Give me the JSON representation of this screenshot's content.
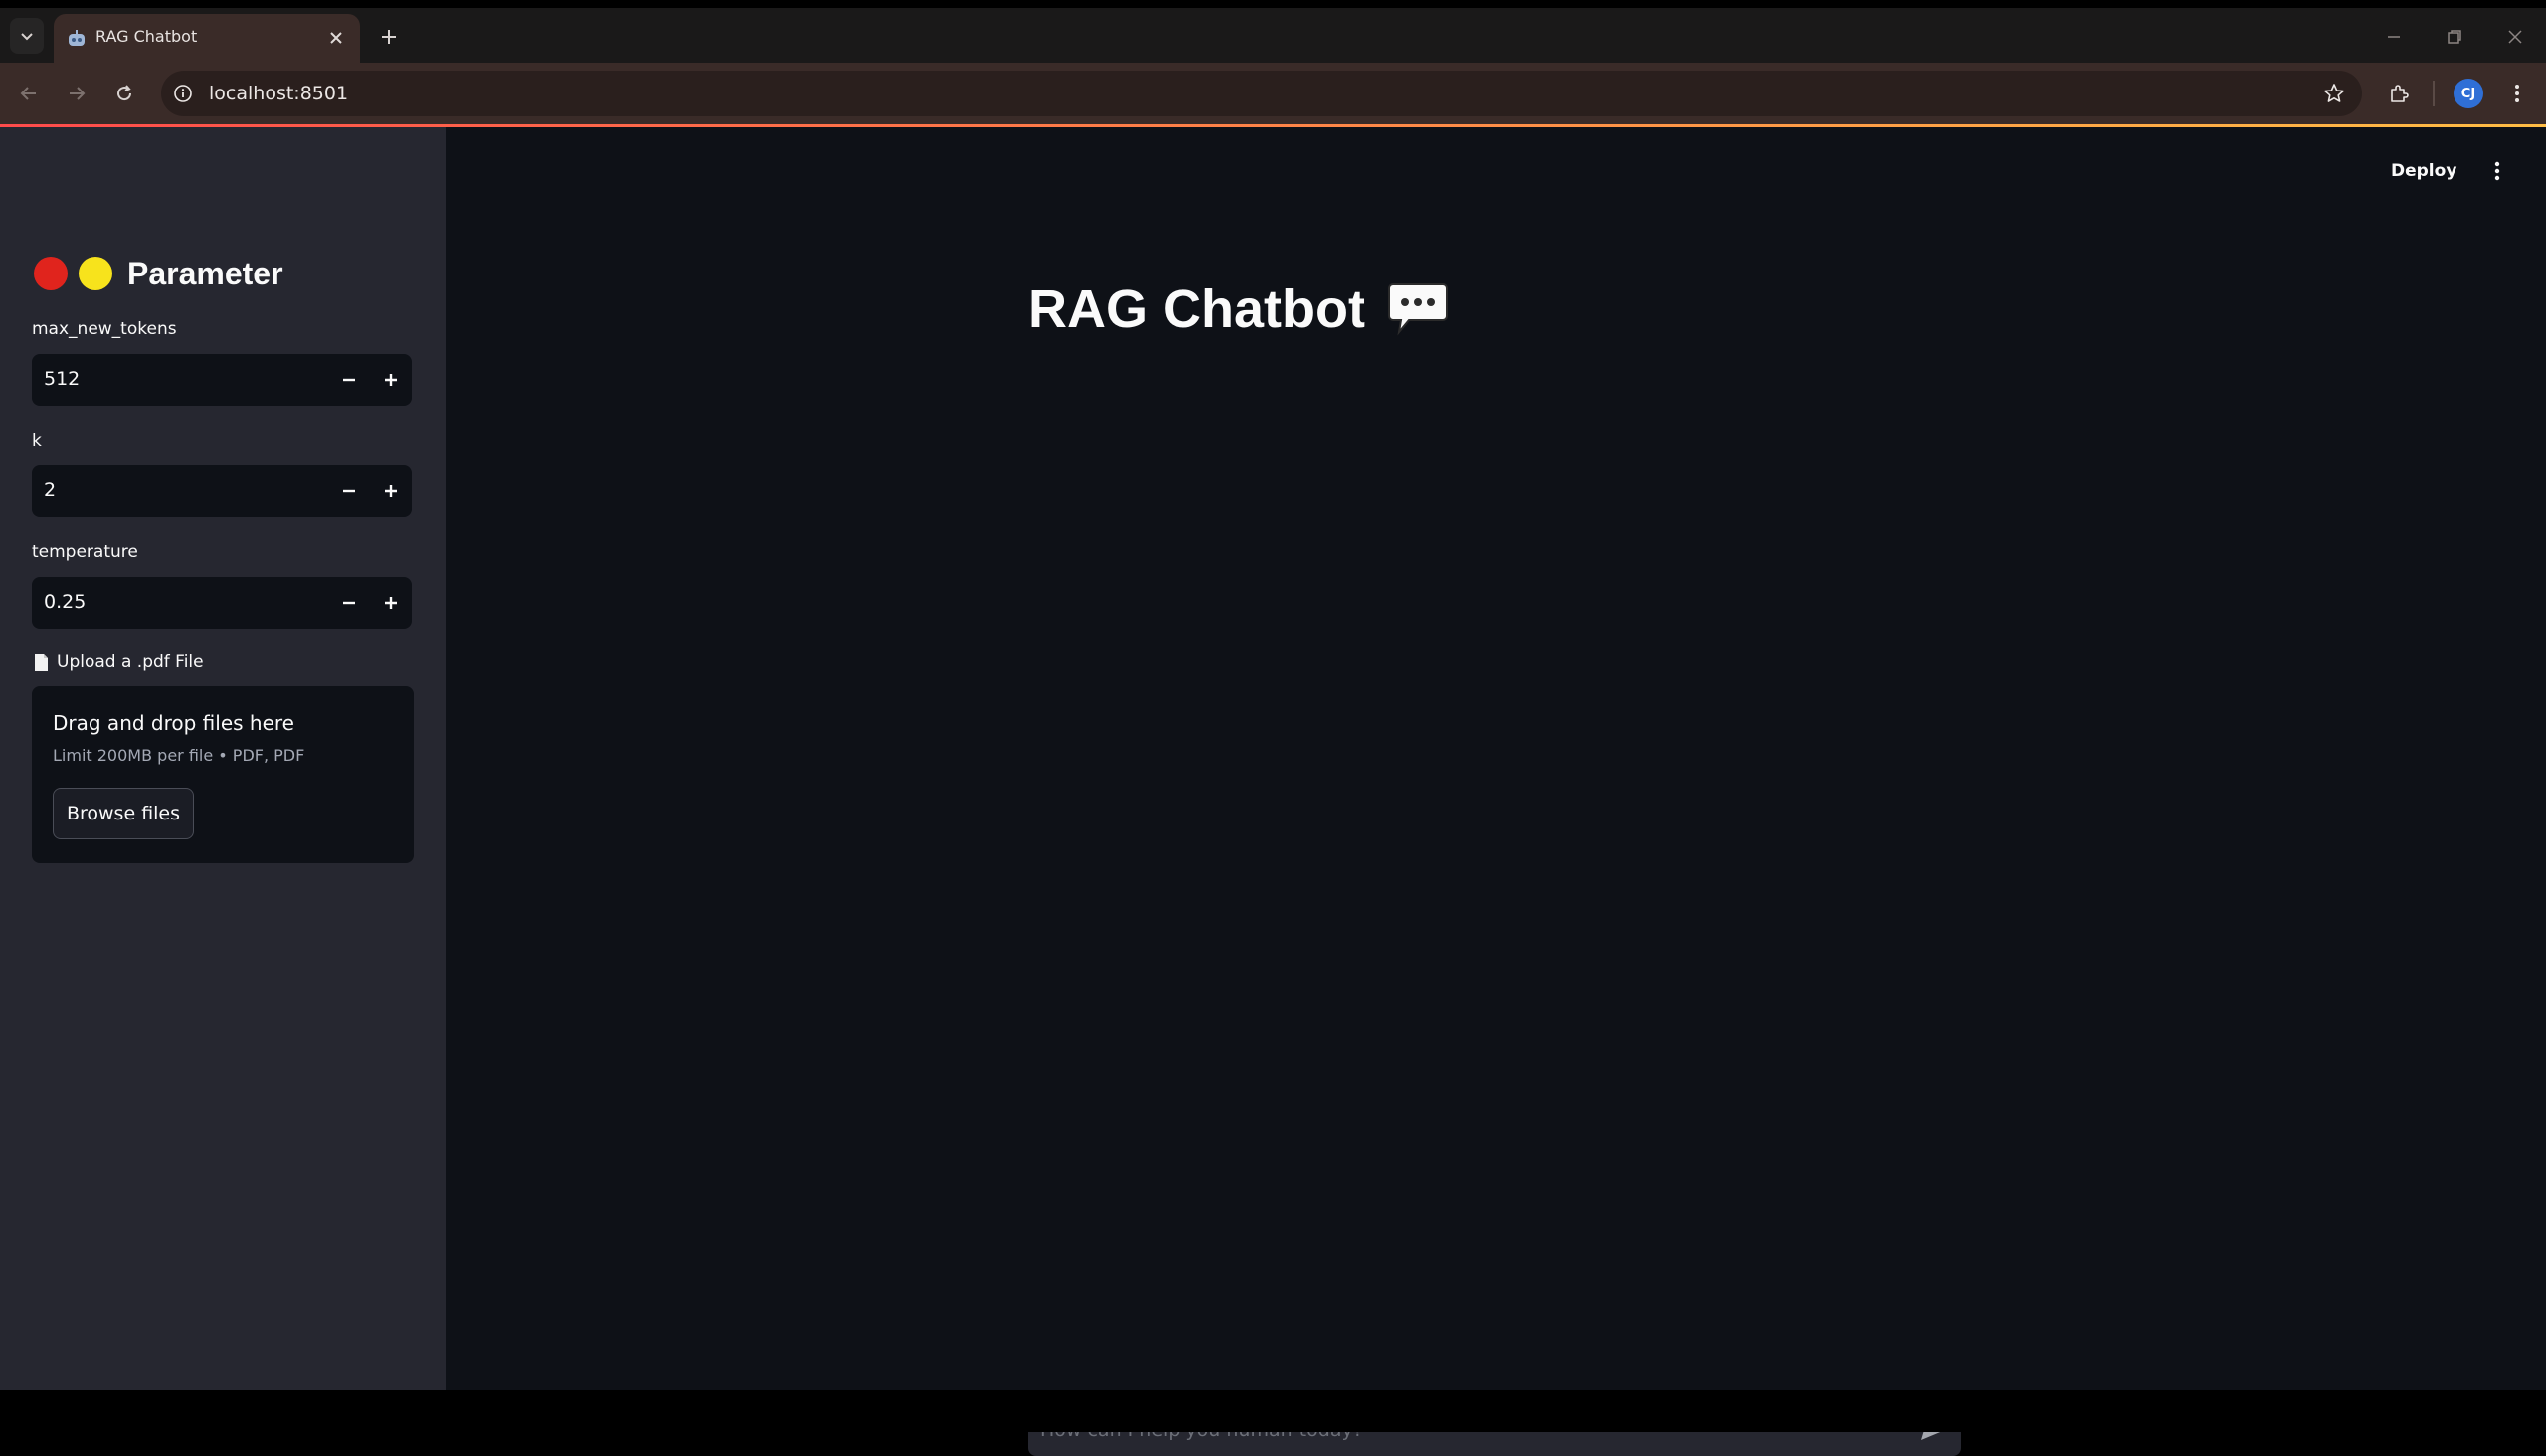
{
  "browser": {
    "tab_title": "RAG Chatbot",
    "url": "localhost:8501",
    "profile_initials": "CJ"
  },
  "app": {
    "deploy_label": "Deploy",
    "page_title": "RAG Chatbot",
    "chat_placeholder": "How can I help you human today?"
  },
  "sidebar": {
    "title": "Parameter",
    "emoji_colors": [
      "#e0241d",
      "#f7e31c"
    ],
    "fields": [
      {
        "label": "max_new_tokens",
        "value": "512"
      },
      {
        "label": "k",
        "value": "2"
      },
      {
        "label": "temperature",
        "value": "0.25"
      }
    ],
    "upload": {
      "label": "Upload a .pdf File",
      "drop_title": "Drag and drop files here",
      "drop_subtitle": "Limit 200MB per file • PDF, PDF",
      "browse_label": "Browse files"
    }
  },
  "colors": {
    "app_background": "#0e1117",
    "sidebar_background": "#262730",
    "browser_frame": "#3a2b28",
    "text": "#fafafa"
  }
}
